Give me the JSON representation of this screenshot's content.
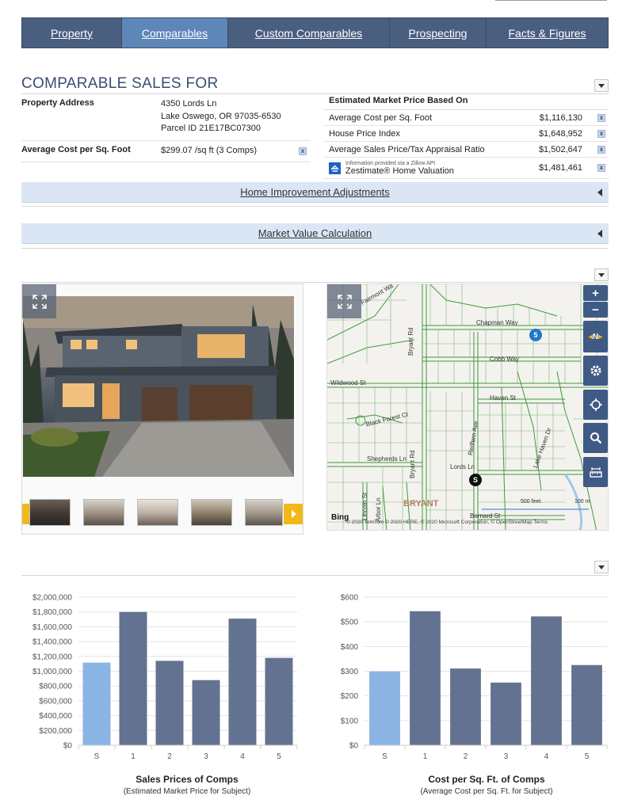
{
  "nav": {
    "tabs": [
      {
        "label": "Property",
        "active": false
      },
      {
        "label": "Comparables",
        "active": true
      },
      {
        "label": "Custom Comparables",
        "active": false
      },
      {
        "label": "Prospecting",
        "active": false
      },
      {
        "label": "Facts & Figures",
        "active": false
      }
    ]
  },
  "section": {
    "title": "COMPARABLE SALES FOR"
  },
  "property": {
    "address_label": "Property Address",
    "street": "4350 Lords Ln",
    "city_line": "Lake Oswego, OR 97035-6530",
    "parcel": "Parcel ID 21E17BC07300",
    "avg_cost_label": "Average Cost per Sq. Foot",
    "avg_cost_value": "$299.07 /sq ft (3 Comps)"
  },
  "estimates": {
    "header": "Estimated Market Price Based On",
    "rows": [
      {
        "label": "Average Cost per Sq. Foot",
        "value": "$1,116,130"
      },
      {
        "label": "House Price Index",
        "value": "$1,648,952"
      },
      {
        "label": "Average Sales Price/Tax Appraisal Ratio",
        "value": "$1,502,647"
      }
    ],
    "zillow_note": "Information provided via a Zillow API",
    "zillow_label": "Zestimate® Home Valuation",
    "zillow_value": "$1,481,461",
    "x_mark": "x"
  },
  "accordions": {
    "home_improvement": "Home Improvement Adjustments",
    "market_value": "Market Value Calculation"
  },
  "map": {
    "streets": [
      "Chapman Way",
      "Cobb Way",
      "Wildwood St",
      "Haven St",
      "Black Forest Ct",
      "Shepherds Ln",
      "Lords Ln",
      "Bernard St",
      "Bryant Rd",
      "Redfern Ave",
      "Lake Haven Dr",
      "Arbor Ln",
      "Lincoln St",
      "Fairmont Wa"
    ],
    "area_label": "BRYANT",
    "markers": [
      {
        "label": "5",
        "color": "#1f78c8"
      },
      {
        "label": "S",
        "color": "#111111"
      }
    ],
    "scale_feet": "500 feet",
    "scale_m": "100 m",
    "provider": "Bing",
    "attribution": "© 2020 TomTom © 2020 HERE, © 2020 Microsoft Corporation, © OpenStreetMap  Terms",
    "controls": {
      "zoom_in": "+",
      "zoom_out": "−",
      "compass": "N"
    }
  },
  "charts": {
    "sales": {
      "title": "Sales Prices of Comps",
      "subtitle": "(Estimated Market Price for Subject)"
    },
    "cost": {
      "title": "Cost per Sq. Ft. of Comps",
      "subtitle": "(Average Cost per Sq. Ft. for Subject)"
    }
  },
  "colors": {
    "subject_bar": "#8ab4e3",
    "comp_bar": "#637290",
    "nav_bg": "#4a5e80",
    "nav_active": "#5e86b8",
    "accordion_bg": "#dbe6f5"
  },
  "chart_data": [
    {
      "type": "bar",
      "title": "Sales Prices of Comps",
      "subtitle": "(Estimated Market Price for Subject)",
      "categories": [
        "S",
        "1",
        "2",
        "3",
        "4",
        "5"
      ],
      "values": [
        1116130,
        1800000,
        1140000,
        880000,
        1710000,
        1180000
      ],
      "ylim": [
        0,
        2000000
      ],
      "yticks": [
        "$0",
        "$200,000",
        "$400,000",
        "$600,000",
        "$800,000",
        "$1,000,000",
        "$1,200,000",
        "$1,400,000",
        "$1,600,000",
        "$1,800,000",
        "$2,000,000"
      ],
      "grid": true,
      "highlight_first": true
    },
    {
      "type": "bar",
      "title": "Cost per Sq. Ft. of Comps",
      "subtitle": "(Average Cost per Sq. Ft. for Subject)",
      "categories": [
        "S",
        "1",
        "2",
        "3",
        "4",
        "5"
      ],
      "values": [
        299,
        543,
        311,
        254,
        522,
        325
      ],
      "ylim": [
        0,
        600
      ],
      "yticks": [
        "$0",
        "$100",
        "$200",
        "$300",
        "$400",
        "$500",
        "$600"
      ],
      "grid": true,
      "highlight_first": true
    }
  ]
}
